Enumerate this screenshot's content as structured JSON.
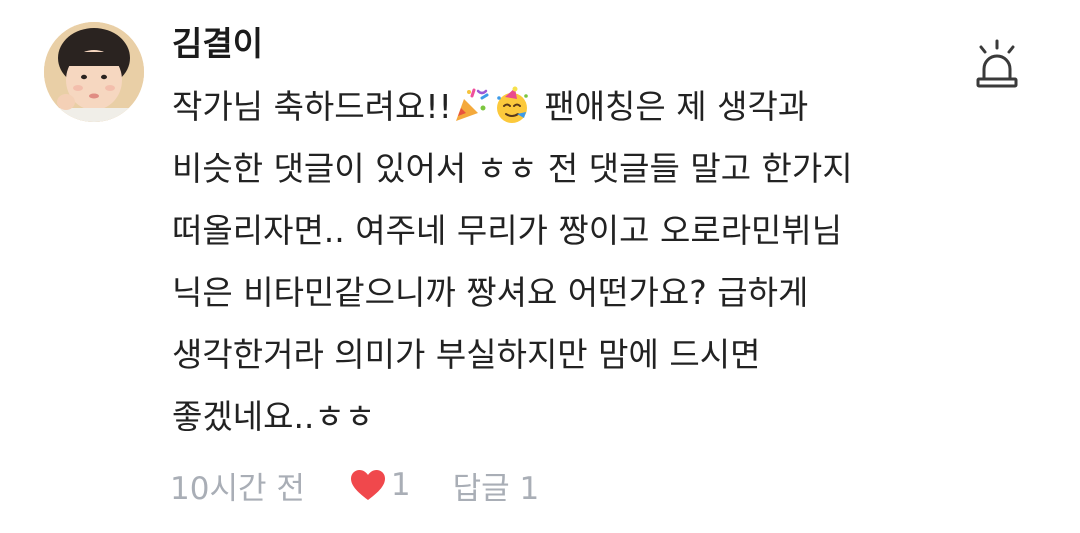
{
  "comment": {
    "username": "김결이",
    "body_lines": [
      {
        "before": "작가님 축하드려요!!",
        "emojis": [
          "party-popper",
          "partying-face"
        ],
        "after": " 팬애칭은 제 생각과"
      },
      {
        "text": "비슷한 댓글이 있어서 ㅎㅎ 전 댓글들 말고 한가지"
      },
      {
        "text": "떠올리자면.. 여주네 무리가 짱이고 오로라민뷔님"
      },
      {
        "text": "닉은 비타민같으니까 짱셔요 어떤가요? 급하게"
      },
      {
        "text": "생각한거라 의미가 부실하지만 맘에 드시면"
      },
      {
        "text": "좋겠네요..ㅎㅎ"
      }
    ],
    "meta": {
      "time": "10시간 전",
      "like_count": "1",
      "reply_label": "답글 1"
    },
    "icons": {
      "report": "siren-icon",
      "like": "heart-icon"
    },
    "colors": {
      "heart": "#f0484c",
      "meta_text": "#a9aeb6",
      "body_text": "#222222"
    }
  }
}
